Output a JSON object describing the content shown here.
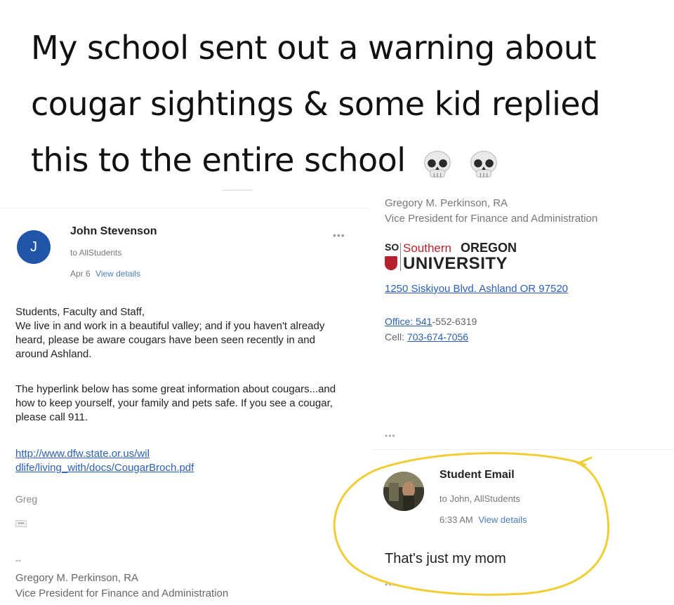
{
  "headline": {
    "line1": "My school sent out a warning about",
    "line2": "cougar sightings & some kid replied",
    "line3": "this to the entire school"
  },
  "email": {
    "avatar_letter": "J",
    "sender": "John Stevenson",
    "recipients": "to AllStudents",
    "date": "Apr 6",
    "view_details": "View details",
    "more": "•••",
    "paragraph1": "Students, Faculty and Staff,\nWe live in and work in a beautiful valley; and if you haven't already heard, please be aware cougars have been seen recently in and around Ashland.",
    "paragraph2": "The hyperlink below has some great information about cougars...and how to keep yourself, your family and pets safe.  If you see a cougar, please call 911.",
    "url_line1": "http://www.dfw.state.or.us/wil",
    "url_line2": "dlife/living_with/docs/CougarBroch.pdf",
    "signoff": "Greg",
    "collapsed": "•••",
    "dash": "--",
    "sig_name": "Gregory M. Perkinson, RA",
    "sig_title": "Vice President for Finance and Administration"
  },
  "right_panel": {
    "name": "Gregory M. Perkinson, RA",
    "title": "Vice President for Finance and Administration",
    "logo": {
      "so": "SO",
      "southern": "Southern",
      "oregon": "OREGON",
      "university": "UNIVERSITY"
    },
    "address": "1250 Siskiyou Blvd. Ashland  OR 97520",
    "office_label": "Office: ",
    "office_link": "541",
    "office_rest": "-552-6319",
    "cell_label": "Cell:  ",
    "cell_link": "703-674-7056",
    "dots": "•••"
  },
  "reply": {
    "sender": "Student Email",
    "recipients": "to John, AllStudents",
    "time": "6:33 AM",
    "view_details": "View details",
    "message": "That's just my mom",
    "dots": "•••"
  },
  "colors": {
    "accent_blue": "#1f56a8",
    "link_blue": "#2a5fb5",
    "brand_red": "#b5222e",
    "highlight_yellow": "#f1cd35"
  },
  "icons": {
    "skull": "skull-icon",
    "avatar": "student-photo-avatar"
  }
}
